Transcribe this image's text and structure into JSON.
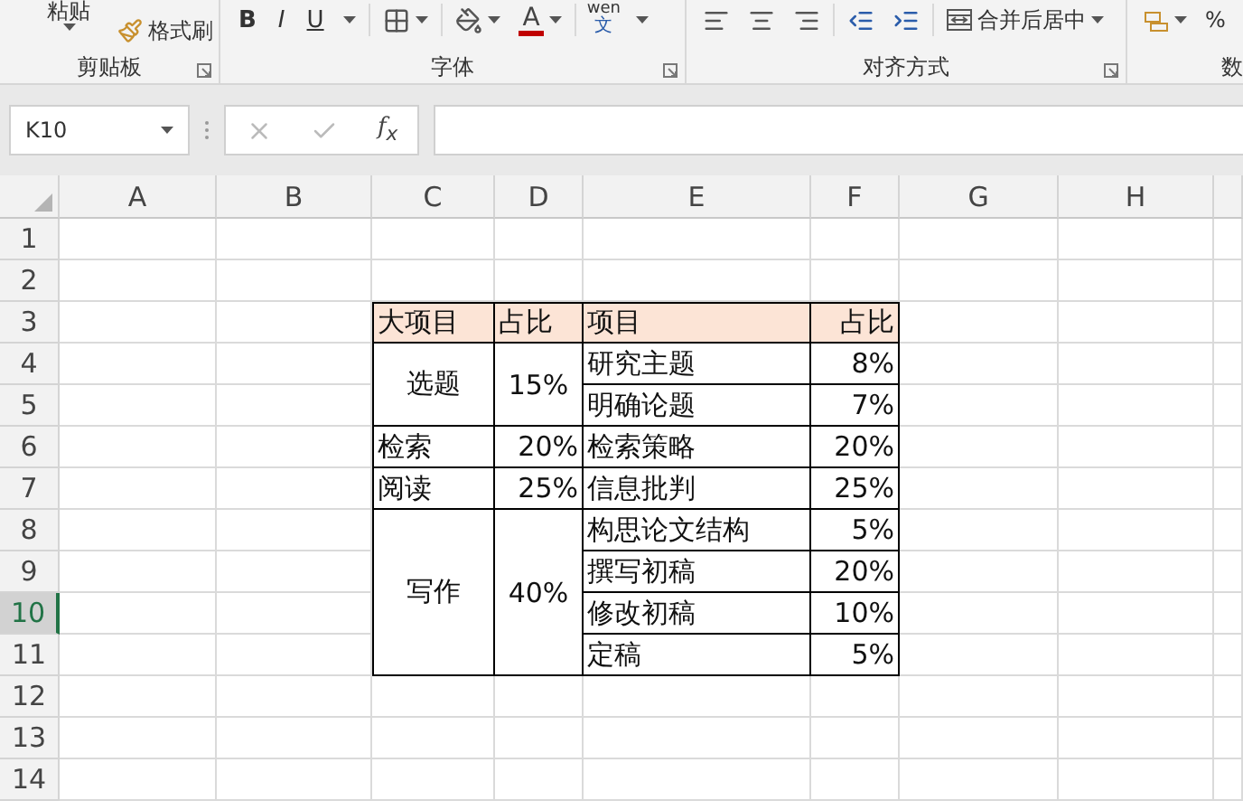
{
  "ribbon": {
    "clipboard": {
      "paste": "粘贴",
      "format_painter": "格式刷",
      "label": "剪贴板"
    },
    "font": {
      "bold": "B",
      "italic": "I",
      "underline": "U",
      "font_color": "A",
      "phonetic_top": "wen",
      "phonetic_bottom": "文",
      "label": "字体"
    },
    "alignment": {
      "merge": "合并后居中",
      "label": "对齐方式"
    },
    "number": {
      "percent": "%",
      "label": "数"
    }
  },
  "formula_bar": {
    "name_box": "K10",
    "function_label": "f$_{x}$"
  },
  "columns": [
    "A",
    "B",
    "C",
    "D",
    "E",
    "F",
    "G",
    "H"
  ],
  "rows": [
    {
      "label": "1",
      "selected": false
    },
    {
      "label": "2",
      "selected": false
    },
    {
      "label": "3",
      "selected": false
    },
    {
      "label": "4",
      "selected": false
    },
    {
      "label": "5",
      "selected": false
    },
    {
      "label": "6",
      "selected": false
    },
    {
      "label": "7",
      "selected": false
    },
    {
      "label": "8",
      "selected": false
    },
    {
      "label": "9",
      "selected": false
    },
    {
      "label": "10",
      "selected": true
    },
    {
      "label": "11",
      "selected": false
    },
    {
      "label": "12",
      "selected": false
    },
    {
      "label": "13",
      "selected": false
    },
    {
      "label": "14",
      "selected": false
    }
  ],
  "table": {
    "header": [
      "大项目",
      "占比",
      "项目",
      "占比"
    ],
    "groups": [
      {
        "name": "选题",
        "share": "15%",
        "items": [
          {
            "name": "研究主题",
            "share": "8%"
          },
          {
            "name": "明确论题",
            "share": "7%"
          }
        ]
      },
      {
        "name": "检索",
        "share": "20%",
        "items": [
          {
            "name": "检索策略",
            "share": "20%"
          }
        ]
      },
      {
        "name": "阅读",
        "share": "25%",
        "items": [
          {
            "name": "信息批判",
            "share": "25%"
          }
        ]
      },
      {
        "name": "写作",
        "share": "40%",
        "items": [
          {
            "name": "构思论文结构",
            "share": "5%"
          },
          {
            "name": "撰写初稿",
            "share": "20%"
          },
          {
            "name": "修改初稿",
            "share": "10%"
          },
          {
            "name": "定稿",
            "share": "5%"
          }
        ]
      }
    ]
  }
}
